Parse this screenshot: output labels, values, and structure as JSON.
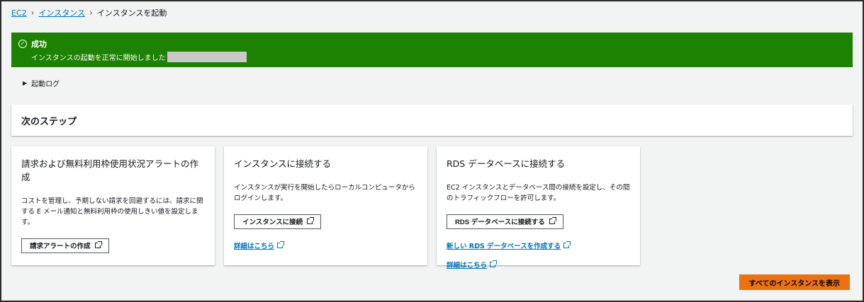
{
  "breadcrumb": {
    "items": [
      "EC2",
      "インスタンス",
      "インスタンスを起動"
    ]
  },
  "flash": {
    "title": "成功",
    "message": "インスタンスの起動を正常に開始しました",
    "icon": "check-circle-icon",
    "color": "#1d8102"
  },
  "launch_log": {
    "label": "起動ログ"
  },
  "next_steps": {
    "title": "次のステップ"
  },
  "cards": [
    {
      "title": "請求および無料利用枠使用状況アラートの作成",
      "description": "コストを管理し、予期しない請求を回避するには、請求に関する E メール通知と無料利用枠の使用しきい値を設定します。",
      "button": "請求アラートの作成"
    },
    {
      "title": "インスタンスに接続する",
      "description": "インスタンスが実行を開始したらローカルコンピュータからログインします。",
      "button": "インスタンスに接続",
      "link1": "詳細はこちら"
    },
    {
      "title": "RDS データベースに接続する",
      "description": "EC2 インスタンスとデータベース間の接続を設定し、その間のトラフィックフローを許可します。",
      "button": "RDS データベースに接続する",
      "link1": "新しい RDS データベースを作成する",
      "link2": "詳細はこちら"
    }
  ],
  "view_all_button": "すべてのインスタンスを表示",
  "colors": {
    "accent": "#ec7211",
    "link": "#0073bb",
    "success": "#1d8102"
  }
}
